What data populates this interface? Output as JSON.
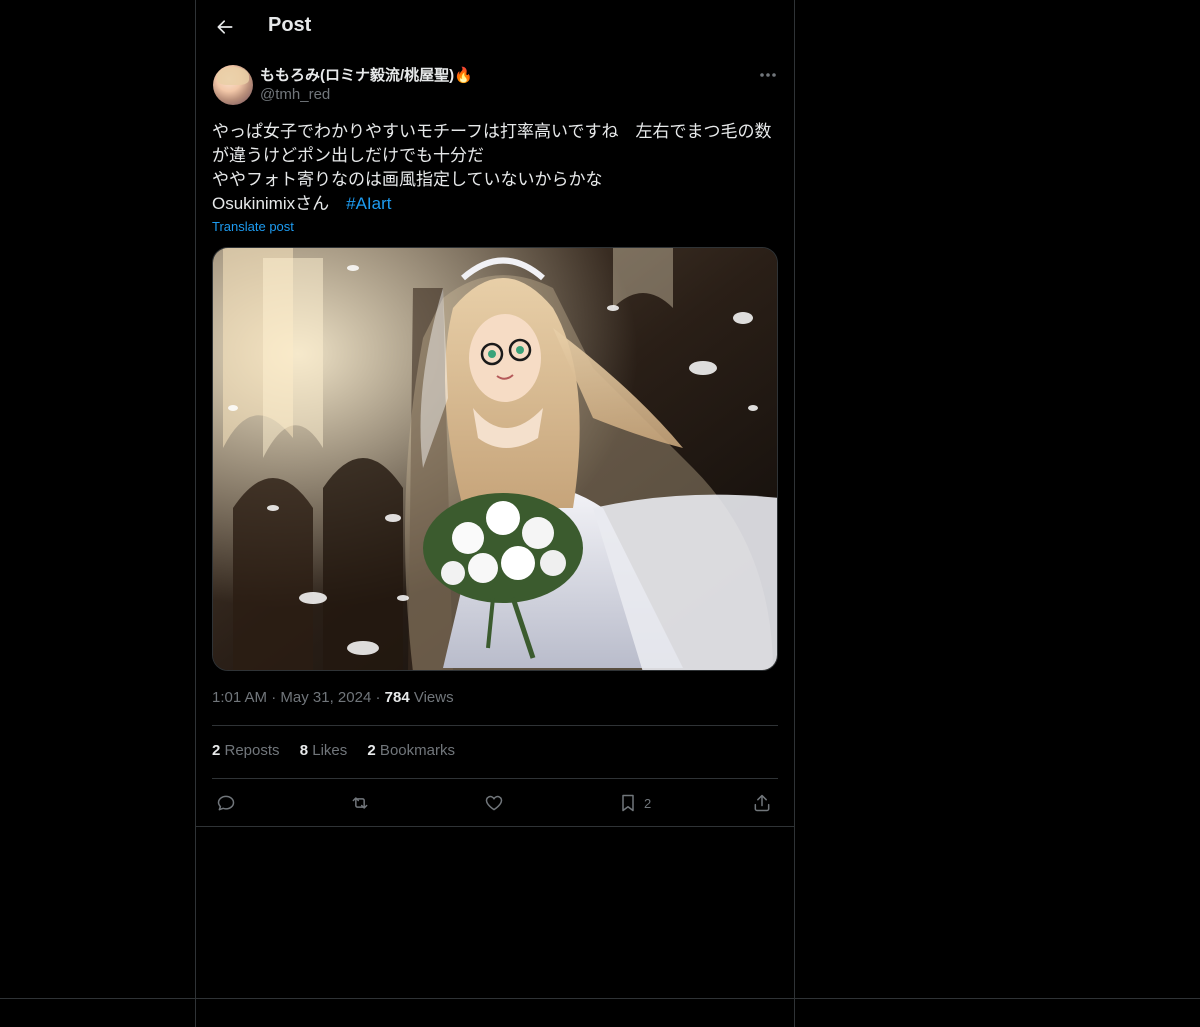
{
  "header": {
    "back_icon": "arrow-left-icon",
    "title": "Post"
  },
  "author": {
    "display_name": "ももろみ(ロミナ毅流/桃屋聖)",
    "emoji": "🔥",
    "handle": "@tmh_red"
  },
  "more_icon": "more-dots-icon",
  "post": {
    "lines": [
      "やっぱ女子でわかりやすいモチーフは打率高いですね　左右でまつ毛の数が違うけどポン出しだけでも十分だ",
      "ややフォト寄りなのは画風指定していないからかな",
      "Osukinimixさん　"
    ],
    "hashtag": "#AIart",
    "translate_label": "Translate post"
  },
  "meta": {
    "time": "1:01 AM",
    "dot1": "·",
    "date": "May 31, 2024",
    "dot2": "·",
    "views_count": "784",
    "views_label": " Views"
  },
  "stats": {
    "reposts_count": "2",
    "reposts_label": " Reposts",
    "likes_count": "8",
    "likes_label": " Likes",
    "bookmarks_count": "2",
    "bookmarks_label": " Bookmarks"
  },
  "actions": {
    "reply_icon": "reply-icon",
    "repost_icon": "repost-icon",
    "like_icon": "heart-icon",
    "bookmark_icon": "bookmark-icon",
    "bookmark_count": "2",
    "share_icon": "share-icon"
  },
  "colors": {
    "background": "#000000",
    "border": "#2f3336",
    "text": "#e7e9ea",
    "muted": "#71767b",
    "accent": "#1d9bf0"
  }
}
